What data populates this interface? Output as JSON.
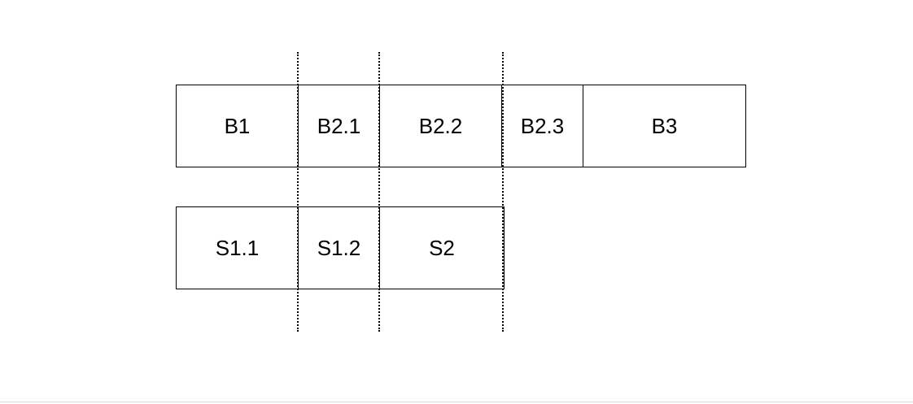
{
  "blocks": {
    "top": [
      "B1",
      "B2.1",
      "B2.2",
      "B2.3",
      "B3"
    ],
    "bottom": [
      "S1.1",
      "S1.2",
      "S2"
    ]
  }
}
